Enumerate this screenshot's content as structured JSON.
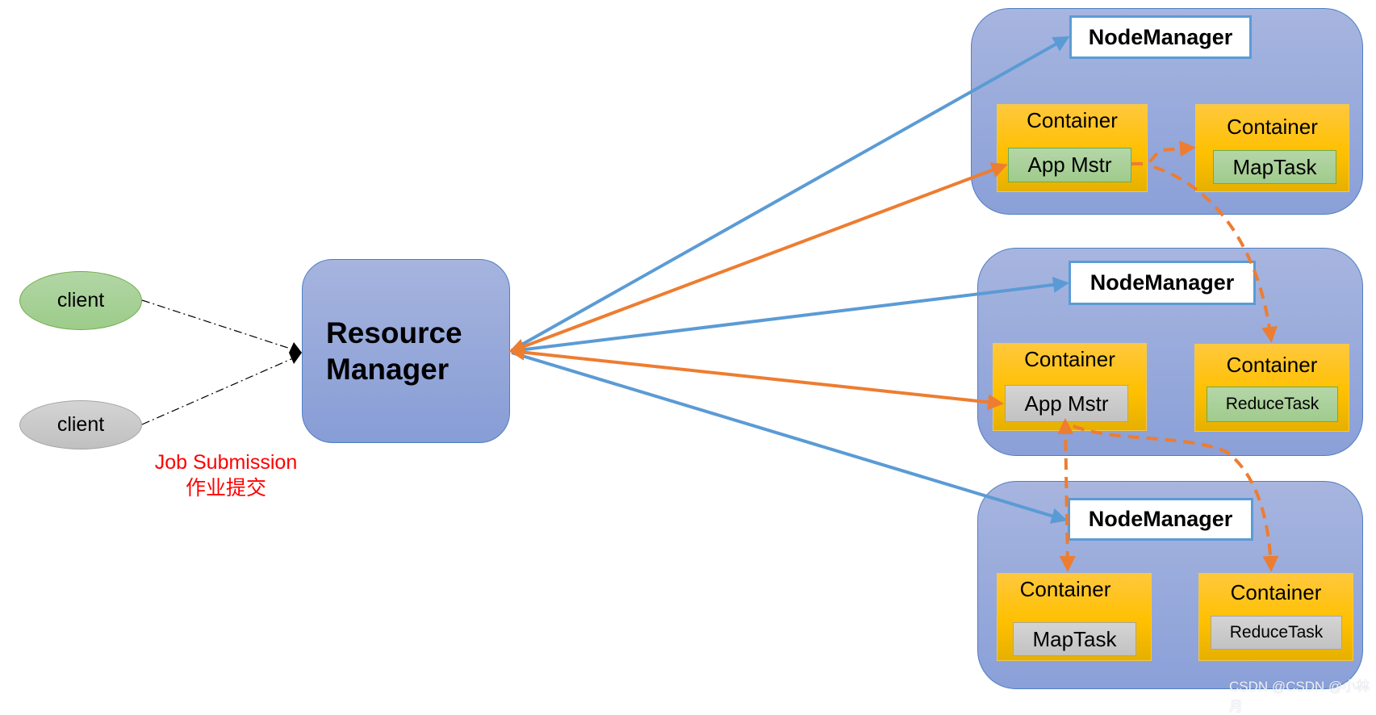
{
  "colors": {
    "control_arrow": "#5b9bd5",
    "app_arrow": "#ed7d31",
    "submission_text": "#ff0000",
    "node_fill": "#94a8da",
    "container_fill": "#ffc000"
  },
  "clients": [
    {
      "label": "client",
      "style": "green"
    },
    {
      "label": "client",
      "style": "gray"
    }
  ],
  "job_submission": {
    "label_en": "Job Submission",
    "label_zh": "作业提交"
  },
  "resource_manager": {
    "line1": "Resource",
    "line2": "Manager"
  },
  "nodes": [
    {
      "node_manager": "NodeManager",
      "containers": [
        {
          "label": "Container",
          "task": "App Mstr",
          "task_style": "green"
        },
        {
          "label": "Container",
          "task": "MapTask",
          "task_style": "green"
        }
      ]
    },
    {
      "node_manager": "NodeManager",
      "containers": [
        {
          "label": "Container",
          "task": "App Mstr",
          "task_style": "gray"
        },
        {
          "label": "Container",
          "task": "ReduceTask",
          "task_style": "green"
        }
      ]
    },
    {
      "node_manager": "NodeManager",
      "containers": [
        {
          "label": "Container",
          "task": "MapTask",
          "task_style": "gray"
        },
        {
          "label": "Container",
          "task": "ReduceTask",
          "task_style": "gray"
        }
      ]
    }
  ],
  "connections": [
    {
      "from": "client-1",
      "to": "resource-manager",
      "style": "dash-dot"
    },
    {
      "from": "client-2",
      "to": "resource-manager",
      "style": "dash-dot"
    },
    {
      "from": "resource-manager",
      "to": "node-1-nodemanager",
      "style": "solid-blue"
    },
    {
      "from": "resource-manager",
      "to": "node-2-nodemanager",
      "style": "solid-blue"
    },
    {
      "from": "resource-manager",
      "to": "node-3-nodemanager",
      "style": "solid-blue"
    },
    {
      "from": "resource-manager",
      "to": "node-1-app-mstr",
      "style": "solid-orange-bidirectional"
    },
    {
      "from": "resource-manager",
      "to": "node-2-app-mstr",
      "style": "solid-orange-bidirectional"
    },
    {
      "from": "node-1-app-mstr",
      "to": "node-1-maptask-container",
      "style": "dashed-orange"
    },
    {
      "from": "node-1-app-mstr",
      "to": "node-2-reducetask-container",
      "style": "dashed-orange"
    },
    {
      "from": "node-2-app-mstr",
      "to": "node-3-maptask-container",
      "style": "dashed-orange"
    },
    {
      "from": "node-2-app-mstr",
      "to": "node-3-reducetask-container",
      "style": "dashed-orange"
    }
  ],
  "watermark": "CSDN @CSDN @小林月"
}
